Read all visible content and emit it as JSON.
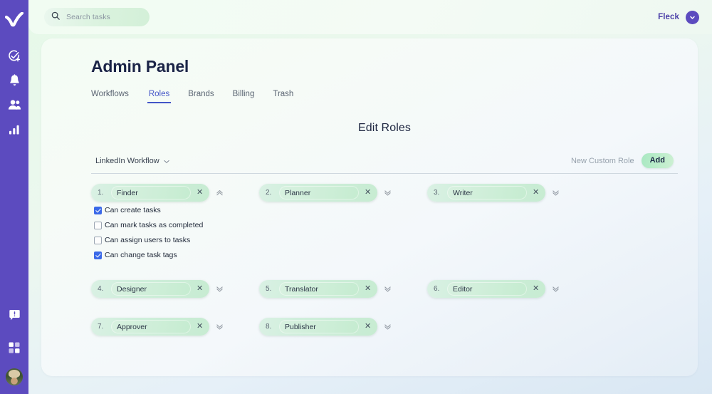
{
  "sidebar": {
    "logo_icon": "check-logo-icon",
    "items": [
      {
        "icon": "add-task-icon",
        "name": "add-task"
      },
      {
        "icon": "bell-icon",
        "name": "notifications"
      },
      {
        "icon": "people-icon",
        "name": "team"
      },
      {
        "icon": "bar-chart-icon",
        "name": "analytics"
      }
    ],
    "bottom": [
      {
        "icon": "feedback-bubble-icon",
        "name": "feedback"
      },
      {
        "icon": "grid-apps-icon",
        "name": "apps"
      }
    ],
    "avatar_name": "user-avatar",
    "background": "#5c4bbf"
  },
  "topbar": {
    "search": {
      "icon": "search-icon",
      "placeholder": "Search tasks",
      "value": ""
    },
    "user": {
      "name": "Fleck",
      "chevron_icon": "chevron-down-icon"
    }
  },
  "page": {
    "title": "Admin Panel",
    "tabs": [
      {
        "label": "Workflows",
        "active": false
      },
      {
        "label": "Roles",
        "active": true
      },
      {
        "label": "Brands",
        "active": false
      },
      {
        "label": "Billing",
        "active": false
      },
      {
        "label": "Trash",
        "active": false
      }
    ],
    "section_title": "Edit Roles"
  },
  "workflow_bar": {
    "selected_workflow": "LinkedIn Workflow",
    "workflow_chevron_icon": "chevron-down-icon",
    "new_role_placeholder": "New Custom Role",
    "new_role_value": "",
    "add_label": "Add"
  },
  "roles": [
    {
      "num": "1.",
      "name": "Finder",
      "expanded": true,
      "toggle_icon": "double-chevron-up-icon",
      "close_icon": "close-icon"
    },
    {
      "num": "2.",
      "name": "Planner",
      "expanded": false,
      "toggle_icon": "double-chevron-down-icon",
      "close_icon": "close-icon"
    },
    {
      "num": "3.",
      "name": "Writer",
      "expanded": false,
      "toggle_icon": "double-chevron-down-icon",
      "close_icon": "close-icon"
    },
    {
      "num": "4.",
      "name": "Designer",
      "expanded": false,
      "toggle_icon": "double-chevron-down-icon",
      "close_icon": "close-icon"
    },
    {
      "num": "5.",
      "name": "Translator",
      "expanded": false,
      "toggle_icon": "double-chevron-down-icon",
      "close_icon": "close-icon"
    },
    {
      "num": "6.",
      "name": "Editor",
      "expanded": false,
      "toggle_icon": "double-chevron-down-icon",
      "close_icon": "close-icon"
    },
    {
      "num": "7.",
      "name": "Approver",
      "expanded": false,
      "toggle_icon": "double-chevron-down-icon",
      "close_icon": "close-icon"
    },
    {
      "num": "8.",
      "name": "Publisher",
      "expanded": false,
      "toggle_icon": "double-chevron-down-icon",
      "close_icon": "close-icon"
    }
  ],
  "permissions": [
    {
      "label": "Can create tasks",
      "checked": true
    },
    {
      "label": "Can mark tasks as completed",
      "checked": false
    },
    {
      "label": "Can assign users to tasks",
      "checked": false
    },
    {
      "label": "Can change task tags",
      "checked": true
    }
  ],
  "colors": {
    "sidebar_purple": "#5c4bbf",
    "accent_blue": "#4355c7",
    "checkbox_blue": "#3b69e8",
    "chip_green": "#cfeedb",
    "title_navy": "#1b2447"
  }
}
